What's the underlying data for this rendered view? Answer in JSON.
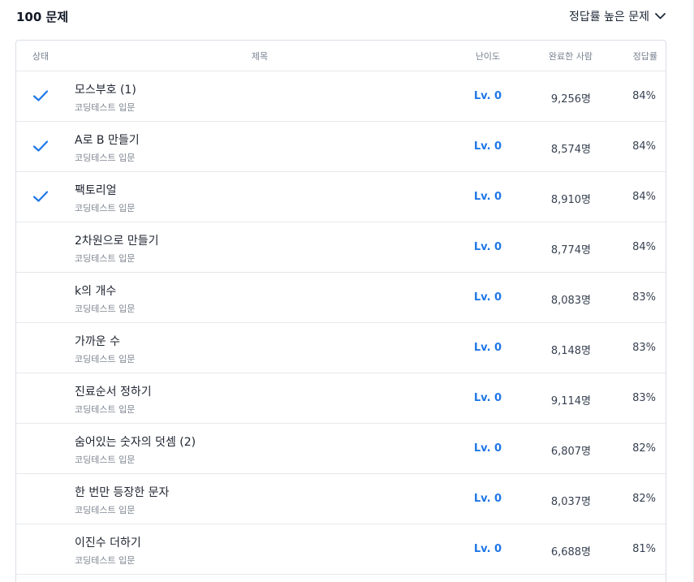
{
  "header": {
    "count_label": "100 문제",
    "sort_label": "정답률 높은 문제"
  },
  "columns": {
    "status": "상태",
    "title": "제목",
    "level": "난이도",
    "completed": "완료한 사람",
    "rate": "정답률"
  },
  "rows": [
    {
      "solved": true,
      "title": "모스부호 (1)",
      "category": "코딩테스트 입문",
      "level": "Lv. 0",
      "completed": "9,256명",
      "rate": "84%"
    },
    {
      "solved": true,
      "title": "A로 B 만들기",
      "category": "코딩테스트 입문",
      "level": "Lv. 0",
      "completed": "8,574명",
      "rate": "84%"
    },
    {
      "solved": true,
      "title": "팩토리얼",
      "category": "코딩테스트 입문",
      "level": "Lv. 0",
      "completed": "8,910명",
      "rate": "84%"
    },
    {
      "solved": false,
      "title": "2차원으로 만들기",
      "category": "코딩테스트 입문",
      "level": "Lv. 0",
      "completed": "8,774명",
      "rate": "84%"
    },
    {
      "solved": false,
      "title": "k의 개수",
      "category": "코딩테스트 입문",
      "level": "Lv. 0",
      "completed": "8,083명",
      "rate": "83%"
    },
    {
      "solved": false,
      "title": "가까운 수",
      "category": "코딩테스트 입문",
      "level": "Lv. 0",
      "completed": "8,148명",
      "rate": "83%"
    },
    {
      "solved": false,
      "title": "진료순서 정하기",
      "category": "코딩테스트 입문",
      "level": "Lv. 0",
      "completed": "9,114명",
      "rate": "83%"
    },
    {
      "solved": false,
      "title": "숨어있는 숫자의 덧셈 (2)",
      "category": "코딩테스트 입문",
      "level": "Lv. 0",
      "completed": "6,807명",
      "rate": "82%"
    },
    {
      "solved": false,
      "title": "한 번만 등장한 문자",
      "category": "코딩테스트 입문",
      "level": "Lv. 0",
      "completed": "8,037명",
      "rate": "82%"
    },
    {
      "solved": false,
      "title": "이진수 더하기",
      "category": "코딩테스트 입문",
      "level": "Lv. 0",
      "completed": "6,688명",
      "rate": "81%"
    }
  ],
  "icons": {
    "solved": "check-icon",
    "sort": "chevron-down-icon"
  },
  "colors": {
    "check": "#1f77e6",
    "level": "#1f77e6"
  }
}
